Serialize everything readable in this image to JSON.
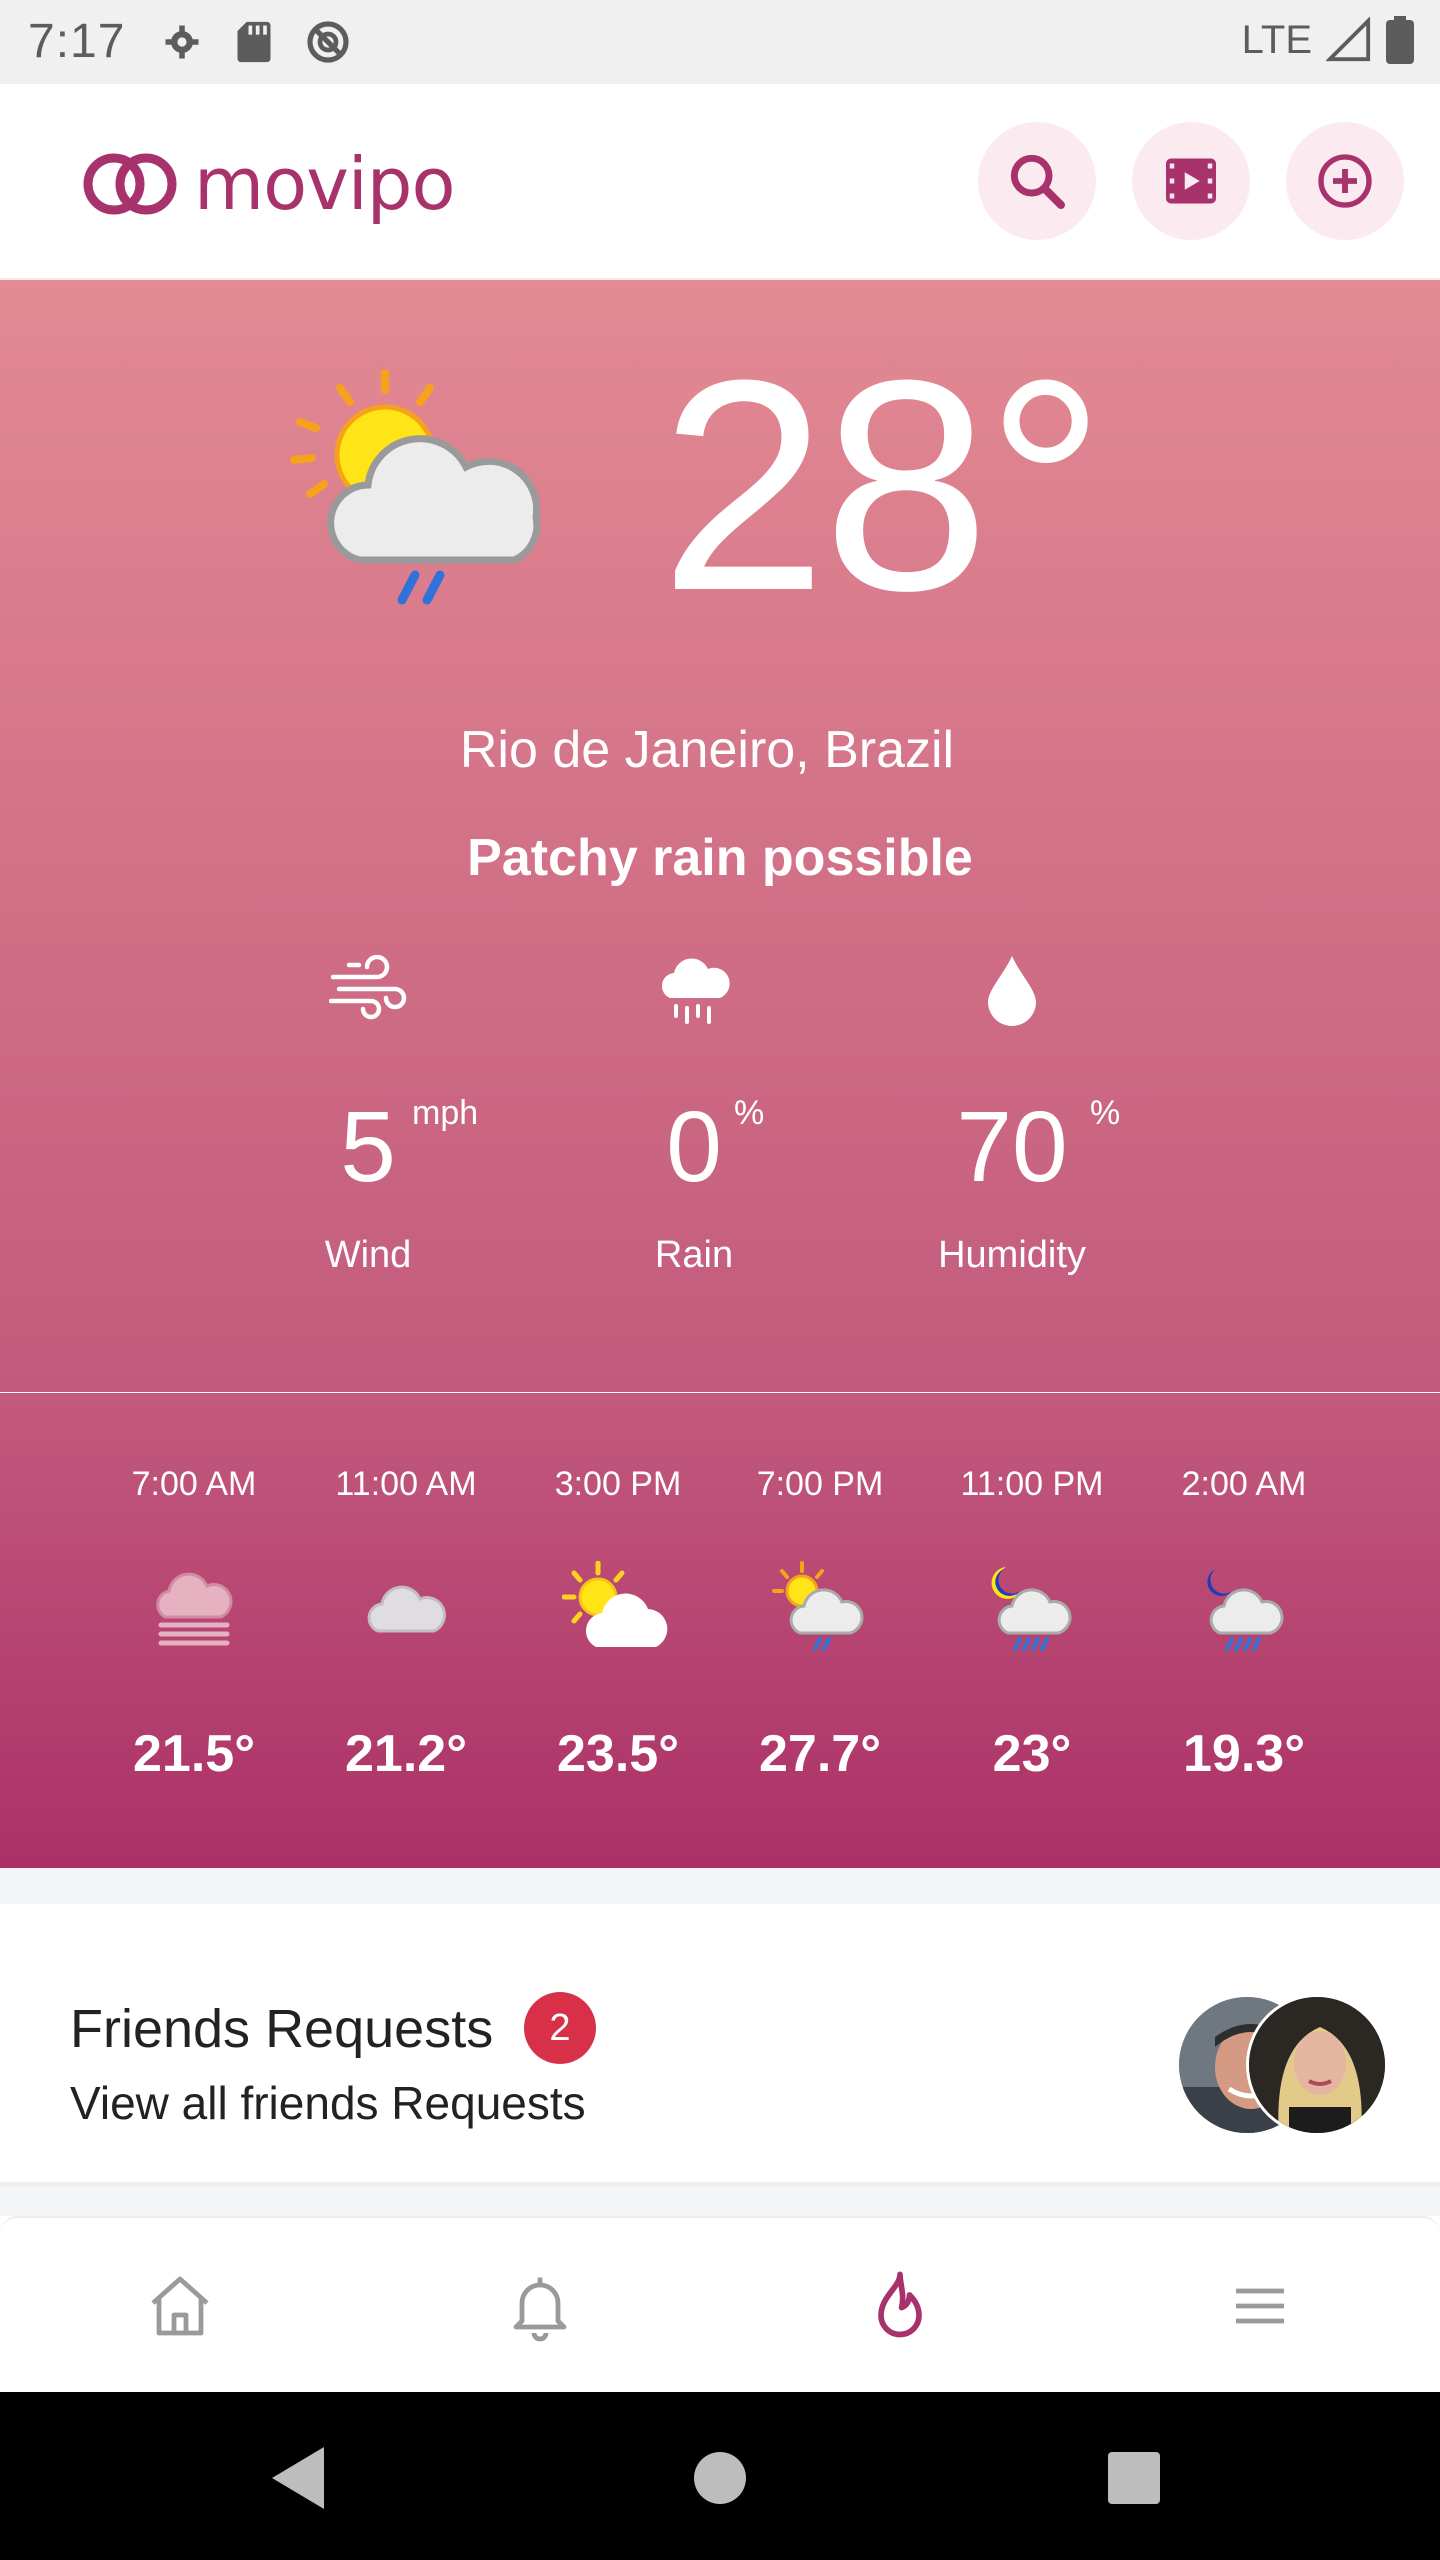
{
  "status_bar": {
    "time": "7:17",
    "network": "LTE"
  },
  "app": {
    "logo_text": "movipo",
    "brand_color": "#a8336c",
    "header_buttons": [
      "search-icon",
      "video-icon",
      "add-circle-icon"
    ]
  },
  "weather": {
    "temperature": "28°",
    "location": "Rio de Janeiro, Brazil",
    "condition": "Patchy rain possible",
    "stats": [
      {
        "label": "Wind",
        "value": "5",
        "unit": "mph",
        "icon": "wind-icon"
      },
      {
        "label": "Rain",
        "value": "0",
        "unit": "%",
        "icon": "rain-cloud-icon"
      },
      {
        "label": "Humidity",
        "value": "70",
        "unit": "%",
        "icon": "droplet-icon"
      }
    ],
    "hourly": [
      {
        "time": "7:00 AM",
        "temp": "21.5°",
        "icon": "fog-icon"
      },
      {
        "time": "11:00 AM",
        "temp": "21.2°",
        "icon": "cloud-icon"
      },
      {
        "time": "3:00 PM",
        "temp": "23.5°",
        "icon": "partly-sunny-icon"
      },
      {
        "time": "7:00 PM",
        "temp": "27.7°",
        "icon": "sun-rain-icon"
      },
      {
        "time": "11:00 PM",
        "temp": "23°",
        "icon": "night-rain-icon"
      },
      {
        "time": "2:00 AM",
        "temp": "19.3°",
        "icon": "night-rain-icon"
      }
    ]
  },
  "friends": {
    "title": "Friends Requests",
    "count": "2",
    "subtitle": "View all friends Requests",
    "badge_color": "#d9304a"
  },
  "bottom_nav": [
    "home-icon",
    "bell-icon",
    "flame-icon",
    "menu-icon"
  ]
}
